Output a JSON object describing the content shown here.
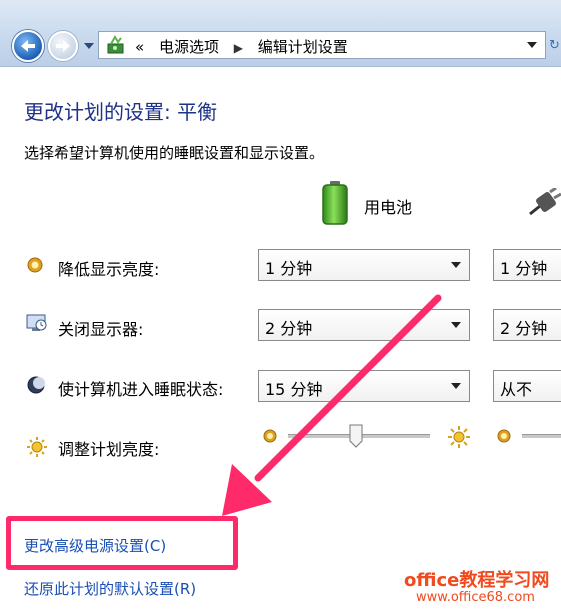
{
  "breadcrumb": {
    "separator": "«",
    "items": [
      "电源选项",
      "编辑计划设置"
    ]
  },
  "page": {
    "title": "更改计划的设置: 平衡",
    "description": "选择希望计算机使用的睡眠设置和显示设置。",
    "columns": {
      "battery": "用电池"
    }
  },
  "settings": [
    {
      "label": "降低显示亮度:",
      "battery": "1 分钟",
      "plugged": "1 分钟"
    },
    {
      "label": "关闭显示器:",
      "battery": "2 分钟",
      "plugged": "2 分钟"
    },
    {
      "label": "使计算机进入睡眠状态:",
      "battery": "15 分钟",
      "plugged": "从不"
    }
  ],
  "brightness": {
    "label": "调整计划亮度:",
    "battery_level": 0.48
  },
  "links": {
    "advanced": "更改高级电源设置(C)",
    "restore": "还原此计划的默认设置(R)"
  },
  "watermark": {
    "title": "office教程学习网",
    "url": "www.office68.com"
  },
  "colors": {
    "title": "#1e3287",
    "link": "#1a4fb4",
    "annotation": "#ff2a6a"
  },
  "icons": {
    "back": "back-arrow-icon",
    "forward": "forward-arrow-icon",
    "battery": "battery-icon",
    "plug": "power-plug-icon"
  }
}
